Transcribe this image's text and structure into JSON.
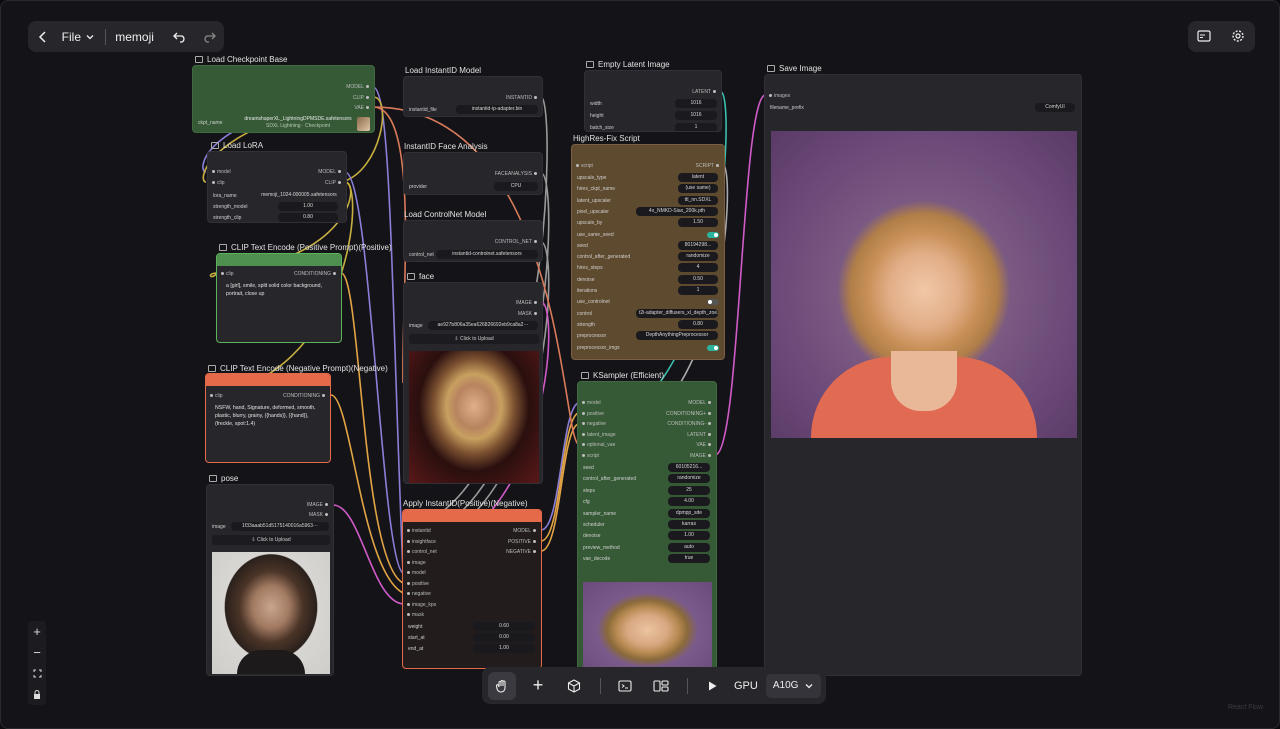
{
  "topbar": {
    "file_label": "File",
    "project": "memoji"
  },
  "toolbar": {
    "gpu_label": "GPU",
    "gpu_value": "A10G"
  },
  "watermark": "React Flow",
  "colors": {
    "accent_teal": "#2bb39b",
    "node_bg": "#26262b",
    "green_node": "#355a35",
    "red_node": "#e46a4a",
    "brown_node": "#5e4a2e"
  },
  "icons": [
    "chevron-left-icon",
    "chevron-down-icon",
    "undo-icon",
    "redo-icon",
    "panel-icon",
    "gear-icon",
    "hand-icon",
    "plus-icon",
    "cube-icon",
    "terminal-icon",
    "layout-icon",
    "play-icon",
    "zoom-in-icon",
    "zoom-out-icon",
    "fit-view-icon",
    "lock-icon"
  ],
  "nodes": {
    "ckpt": {
      "title": "Load Checkpoint Base",
      "out_model": "MODEL",
      "out_clip": "CLIP",
      "out_vae": "VAE",
      "ckpt_label": "ckpt_name",
      "ckpt_value": "dreamshaperXL_LightningDPMSDE.safetensors",
      "ckpt_sub": "SDXL Lightning · Checkpoint"
    },
    "lora": {
      "title": "Load LoRA",
      "in_model": "model",
      "in_clip": "clip",
      "out_model": "MODEL",
      "out_clip": "CLIP",
      "lora_label": "lora_name",
      "lora_value": "memoji_1024-000005.safetensors",
      "sm_label": "strength_model",
      "sm_value": "1.00",
      "sc_label": "strength_clip",
      "sc_value": "0.80"
    },
    "pos": {
      "title": "CLIP Text Encode (Positive Prompt)(Positive)",
      "in_clip": "clip",
      "out": "CONDITIONING",
      "text": "a [girl], smile, split solid color background, portrait, close up"
    },
    "neg": {
      "title": "CLIP Text Encode (Negative Prompt)(Negative)",
      "in_clip": "clip",
      "out": "CONDITIONING",
      "text": "NSFW, hand, Signature, deformed, smooth, plastic, blurry, grainy, {{hands}}, {{hand}}, (freckle, spot:1.4)"
    },
    "pose": {
      "title": "pose",
      "out_image": "IMAGE",
      "out_mask": "MASK",
      "image_label": "image",
      "image_value": "1f33aaab51d5175140016a5963···",
      "upload": "Click to Upload"
    },
    "instid": {
      "title": "Load InstantID Model",
      "out": "INSTANTID",
      "label": "instantid_file",
      "value": "instantid-ip-adapter.bin"
    },
    "face_an": {
      "title": "InstantID Face Analysis",
      "out": "FACEANALYSIS",
      "label": "provider",
      "value": "CPU"
    },
    "cnet": {
      "title": "Load ControlNet Model",
      "out": "CONTROL_NET",
      "label": "control_net",
      "value": "instantid-controlnet.safetensors"
    },
    "face": {
      "title": "face",
      "out_image": "IMAGE",
      "out_mask": "MASK",
      "image_label": "image",
      "image_value": "ae927b806a35ea626826692eb9ca8a2···",
      "upload": "Click to Upload"
    },
    "apply": {
      "title": "Apply InstantID(Positive)(Negative)",
      "ins": [
        "instantid",
        "insightface",
        "control_net",
        "image",
        "model",
        "positive",
        "negative",
        "image_kps",
        "mask"
      ],
      "outs": [
        "MODEL",
        "POSITIVE",
        "NEGATIVE"
      ],
      "w_label": "weight",
      "w_value": "0.60",
      "s_label": "start_at",
      "s_value": "0.00",
      "e_label": "end_at",
      "e_value": "1.00"
    },
    "latent": {
      "title": "Empty Latent Image",
      "out": "LATENT",
      "w_label": "width",
      "w_value": "1016",
      "h_label": "height",
      "h_value": "1016",
      "b_label": "batch_size",
      "b_value": "1"
    },
    "hires": {
      "title": "HighRes-Fix Script",
      "in": "script",
      "out": "SCRIPT",
      "rows": [
        {
          "label": "upscale_type",
          "value": "latent"
        },
        {
          "label": "hires_ckpt_name",
          "value": "(use same)"
        },
        {
          "label": "latent_upscaler",
          "value": "ttl_nn.SDXL"
        },
        {
          "label": "pixel_upscaler",
          "value": "4x_NMKD-Siax_200k.pth"
        },
        {
          "label": "upscale_by",
          "value": "1.50"
        },
        {
          "label": "use_same_seed",
          "value": ""
        },
        {
          "label": "seed",
          "value": "80194298..."
        },
        {
          "label": "control_after_generated",
          "value": "randomize"
        },
        {
          "label": "hires_steps",
          "value": "4"
        },
        {
          "label": "denoise",
          "value": "0.50"
        },
        {
          "label": "iterations",
          "value": "1"
        },
        {
          "label": "use_controlnet",
          "value": ""
        },
        {
          "label": "control",
          "value": "t2i-adapter_diffusers_xl_depth_zoe.saf···"
        },
        {
          "label": "strength",
          "value": "0.80"
        },
        {
          "label": "preprocessor",
          "value": "DepthAnythingPreprocessor"
        },
        {
          "label": "preprocessor_imgs",
          "value": ""
        }
      ]
    },
    "ks": {
      "title": "KSampler (Efficient)",
      "ins": [
        "model",
        "positive",
        "negative",
        "latent_image",
        "optional_vae",
        "script"
      ],
      "outs": [
        "MODEL",
        "CONDITIONING+",
        "CONDITIONING-",
        "LATENT",
        "VAE",
        "IMAGE"
      ],
      "rows": [
        {
          "label": "seed",
          "value": "60105216..."
        },
        {
          "label": "control_after_generated",
          "value": "randomize"
        },
        {
          "label": "steps",
          "value": "25"
        },
        {
          "label": "cfg",
          "value": "4.00"
        },
        {
          "label": "sampler_name",
          "value": "dpmpp_sde"
        },
        {
          "label": "scheduler",
          "value": "karras"
        },
        {
          "label": "denoise",
          "value": "1.00"
        },
        {
          "label": "preview_method",
          "value": "auto"
        },
        {
          "label": "vae_decode",
          "value": "true"
        }
      ]
    },
    "save": {
      "title": "Save Image",
      "in": "images",
      "label": "filename_prefix",
      "value": "ComfyUI"
    }
  }
}
